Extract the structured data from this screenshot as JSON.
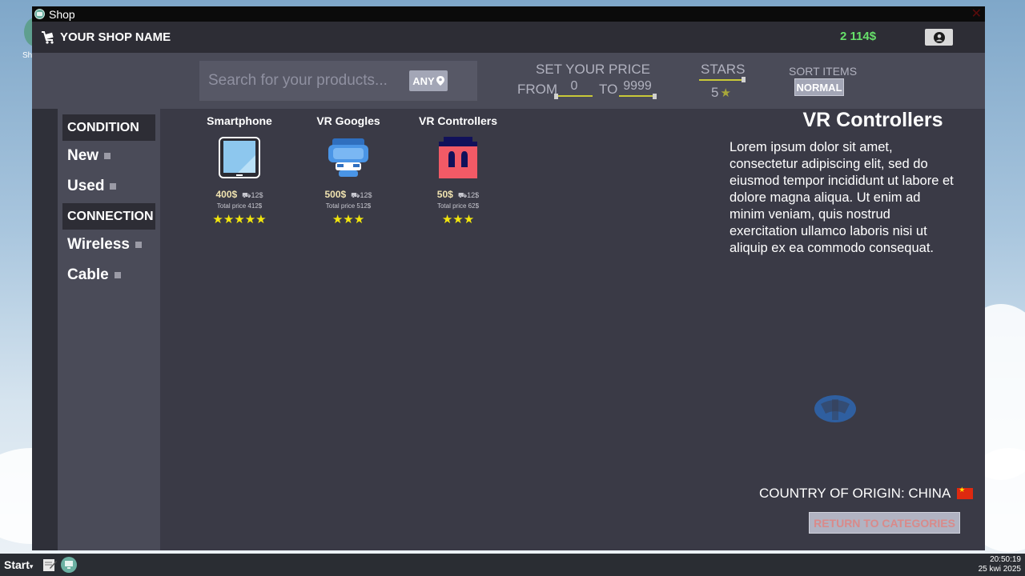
{
  "desktop": {
    "icon_label": "Sh"
  },
  "window": {
    "title": "Shop"
  },
  "shopbar": {
    "shop_name": "YOUR SHOP NAME",
    "money": "2 114$"
  },
  "filters": {
    "search_placeholder": "Search for your products...",
    "any_label": "ANY",
    "price_title": "SET YOUR PRICE",
    "from_label": "FROM",
    "to_label": "TO",
    "price_from": "0",
    "price_to": "9999",
    "stars_title": "STARS",
    "stars_value": "5",
    "sort_title": "SORT ITEMS",
    "sort_value": "NORMAL"
  },
  "sidebar": {
    "condition_header": "CONDITION",
    "condition_items": [
      "New",
      "Used"
    ],
    "connection_header": "CONNECTION",
    "connection_items": [
      "Wireless",
      "Cable"
    ]
  },
  "products": [
    {
      "name": "Smartphone",
      "price": "400$",
      "shipping": "12$",
      "total": "Total price 412$",
      "stars": "★★★★★"
    },
    {
      "name": "VR Googles",
      "price": "500$",
      "shipping": "12$",
      "total": "Total price 512$",
      "stars": "★★★"
    },
    {
      "name": "VR Controllers",
      "price": "50$",
      "shipping": "12$",
      "total": "Total price 62$",
      "stars": "★★★"
    }
  ],
  "detail": {
    "title": "VR Controllers",
    "description": "Lorem ipsum dolor sit amet, consectetur adipiscing elit, sed do eiusmod tempor incididunt ut labore et dolore magna aliqua. Ut enim ad minim veniam, quis nostrud exercitation ullamco laboris nisi ut aliquip ex ea commodo consequat.",
    "origin": "COUNTRY OF ORIGIN: CHINA",
    "return_label": "RETURN TO CATEGORIES"
  },
  "taskbar": {
    "start_label": "Start",
    "time": "20:50:19",
    "date": "25 kwi 2025"
  },
  "colors": {
    "money": "#67e06a",
    "accent_line": "#c9c938",
    "star": "#f2e60d",
    "return_text": "#d98a8a"
  }
}
